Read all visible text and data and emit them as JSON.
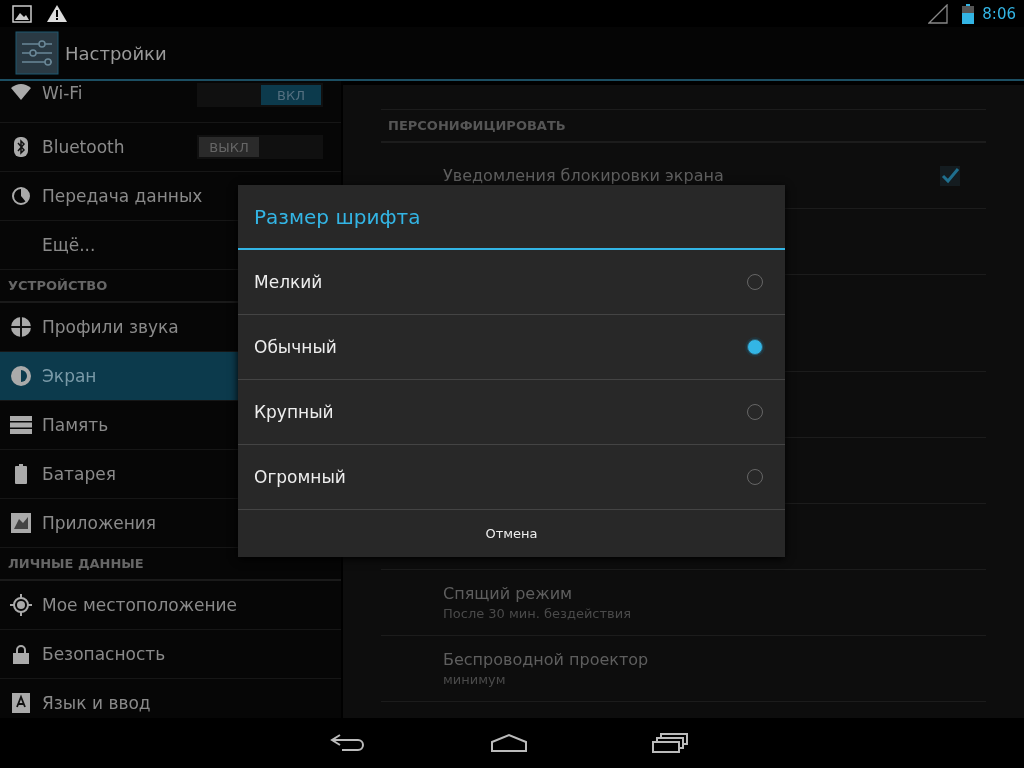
{
  "status_bar": {
    "time": "8:06"
  },
  "action_bar": {
    "title": "Настройки"
  },
  "sidebar": {
    "items": [
      {
        "kind": "item",
        "label": "Wi-Fi",
        "toggle": {
          "label": "ВКЛ",
          "on": true
        },
        "selected": false
      },
      {
        "kind": "item",
        "label": "Bluetooth",
        "toggle": {
          "label": "ВЫКЛ",
          "on": false
        },
        "selected": false
      },
      {
        "kind": "item",
        "label": "Передача данных",
        "selected": false
      },
      {
        "kind": "item",
        "label": "Ещё...",
        "selected": false
      },
      {
        "kind": "header",
        "label": "УСТРОЙСТВО"
      },
      {
        "kind": "item",
        "label": "Профили звука",
        "selected": false
      },
      {
        "kind": "item",
        "label": "Экран",
        "selected": true
      },
      {
        "kind": "item",
        "label": "Память",
        "selected": false
      },
      {
        "kind": "item",
        "label": "Батарея",
        "selected": false
      },
      {
        "kind": "item",
        "label": "Приложения",
        "selected": false
      },
      {
        "kind": "header",
        "label": "ЛИЧНЫЕ ДАННЫЕ"
      },
      {
        "kind": "item",
        "label": "Мое местоположение",
        "selected": false
      },
      {
        "kind": "item",
        "label": "Безопасность",
        "selected": false
      },
      {
        "kind": "item",
        "label": "Язык и ввод",
        "selected": false
      }
    ]
  },
  "content": {
    "items": [
      {
        "kind": "header",
        "title": "ПЕРСОНИФИЦИРОВАТЬ"
      },
      {
        "kind": "checkbox",
        "title": "Уведомления блокировки экрана",
        "checked": true
      },
      {
        "kind": "setting",
        "title": "Спящий режим",
        "summary": "После 30 мин. бездействия"
      },
      {
        "kind": "setting",
        "title": "Беспроводной проектор",
        "summary": "минимум"
      }
    ]
  },
  "dialog": {
    "title": "Размер шрифта",
    "options": [
      {
        "label": "Мелкий",
        "selected": false
      },
      {
        "label": "Обычный",
        "selected": true
      },
      {
        "label": "Крупный",
        "selected": false
      },
      {
        "label": "Огромный",
        "selected": false
      }
    ],
    "cancel": "Отмена"
  }
}
